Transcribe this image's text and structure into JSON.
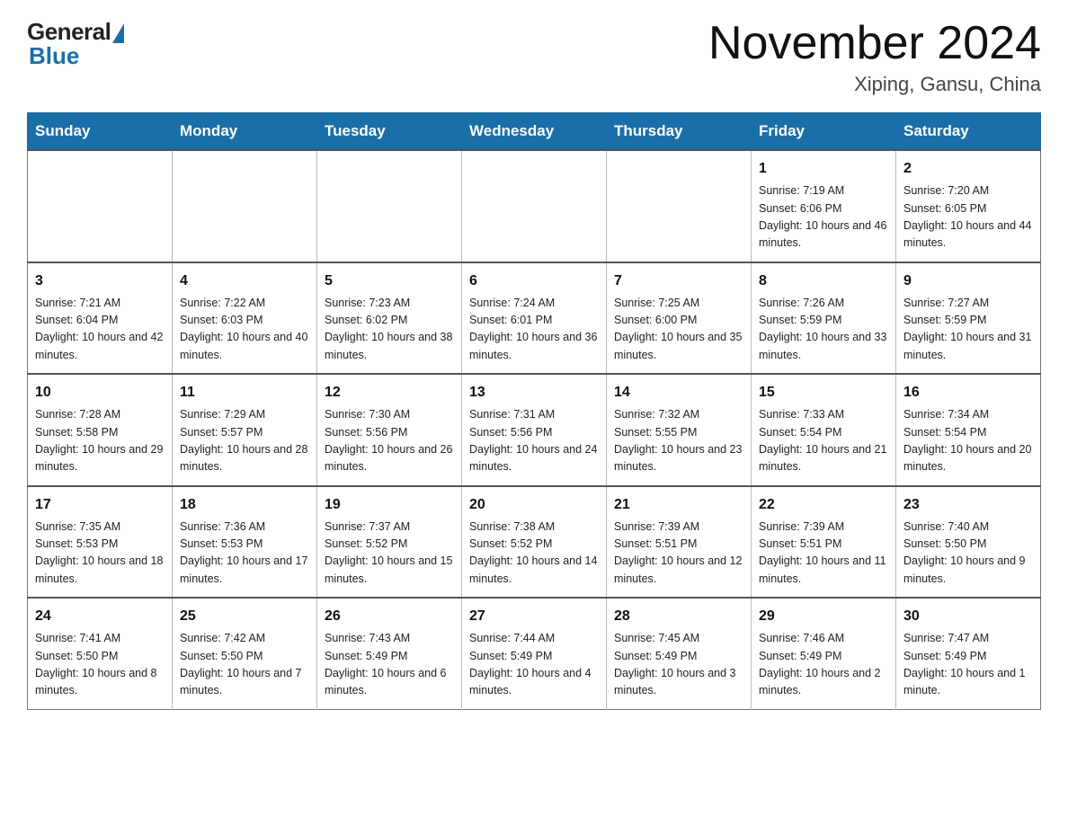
{
  "header": {
    "logo_general": "General",
    "logo_blue": "Blue",
    "month_title": "November 2024",
    "location": "Xiping, Gansu, China"
  },
  "weekdays": [
    "Sunday",
    "Monday",
    "Tuesday",
    "Wednesday",
    "Thursday",
    "Friday",
    "Saturday"
  ],
  "weeks": [
    [
      {
        "day": "",
        "info": ""
      },
      {
        "day": "",
        "info": ""
      },
      {
        "day": "",
        "info": ""
      },
      {
        "day": "",
        "info": ""
      },
      {
        "day": "",
        "info": ""
      },
      {
        "day": "1",
        "info": "Sunrise: 7:19 AM\nSunset: 6:06 PM\nDaylight: 10 hours and 46 minutes."
      },
      {
        "day": "2",
        "info": "Sunrise: 7:20 AM\nSunset: 6:05 PM\nDaylight: 10 hours and 44 minutes."
      }
    ],
    [
      {
        "day": "3",
        "info": "Sunrise: 7:21 AM\nSunset: 6:04 PM\nDaylight: 10 hours and 42 minutes."
      },
      {
        "day": "4",
        "info": "Sunrise: 7:22 AM\nSunset: 6:03 PM\nDaylight: 10 hours and 40 minutes."
      },
      {
        "day": "5",
        "info": "Sunrise: 7:23 AM\nSunset: 6:02 PM\nDaylight: 10 hours and 38 minutes."
      },
      {
        "day": "6",
        "info": "Sunrise: 7:24 AM\nSunset: 6:01 PM\nDaylight: 10 hours and 36 minutes."
      },
      {
        "day": "7",
        "info": "Sunrise: 7:25 AM\nSunset: 6:00 PM\nDaylight: 10 hours and 35 minutes."
      },
      {
        "day": "8",
        "info": "Sunrise: 7:26 AM\nSunset: 5:59 PM\nDaylight: 10 hours and 33 minutes."
      },
      {
        "day": "9",
        "info": "Sunrise: 7:27 AM\nSunset: 5:59 PM\nDaylight: 10 hours and 31 minutes."
      }
    ],
    [
      {
        "day": "10",
        "info": "Sunrise: 7:28 AM\nSunset: 5:58 PM\nDaylight: 10 hours and 29 minutes."
      },
      {
        "day": "11",
        "info": "Sunrise: 7:29 AM\nSunset: 5:57 PM\nDaylight: 10 hours and 28 minutes."
      },
      {
        "day": "12",
        "info": "Sunrise: 7:30 AM\nSunset: 5:56 PM\nDaylight: 10 hours and 26 minutes."
      },
      {
        "day": "13",
        "info": "Sunrise: 7:31 AM\nSunset: 5:56 PM\nDaylight: 10 hours and 24 minutes."
      },
      {
        "day": "14",
        "info": "Sunrise: 7:32 AM\nSunset: 5:55 PM\nDaylight: 10 hours and 23 minutes."
      },
      {
        "day": "15",
        "info": "Sunrise: 7:33 AM\nSunset: 5:54 PM\nDaylight: 10 hours and 21 minutes."
      },
      {
        "day": "16",
        "info": "Sunrise: 7:34 AM\nSunset: 5:54 PM\nDaylight: 10 hours and 20 minutes."
      }
    ],
    [
      {
        "day": "17",
        "info": "Sunrise: 7:35 AM\nSunset: 5:53 PM\nDaylight: 10 hours and 18 minutes."
      },
      {
        "day": "18",
        "info": "Sunrise: 7:36 AM\nSunset: 5:53 PM\nDaylight: 10 hours and 17 minutes."
      },
      {
        "day": "19",
        "info": "Sunrise: 7:37 AM\nSunset: 5:52 PM\nDaylight: 10 hours and 15 minutes."
      },
      {
        "day": "20",
        "info": "Sunrise: 7:38 AM\nSunset: 5:52 PM\nDaylight: 10 hours and 14 minutes."
      },
      {
        "day": "21",
        "info": "Sunrise: 7:39 AM\nSunset: 5:51 PM\nDaylight: 10 hours and 12 minutes."
      },
      {
        "day": "22",
        "info": "Sunrise: 7:39 AM\nSunset: 5:51 PM\nDaylight: 10 hours and 11 minutes."
      },
      {
        "day": "23",
        "info": "Sunrise: 7:40 AM\nSunset: 5:50 PM\nDaylight: 10 hours and 9 minutes."
      }
    ],
    [
      {
        "day": "24",
        "info": "Sunrise: 7:41 AM\nSunset: 5:50 PM\nDaylight: 10 hours and 8 minutes."
      },
      {
        "day": "25",
        "info": "Sunrise: 7:42 AM\nSunset: 5:50 PM\nDaylight: 10 hours and 7 minutes."
      },
      {
        "day": "26",
        "info": "Sunrise: 7:43 AM\nSunset: 5:49 PM\nDaylight: 10 hours and 6 minutes."
      },
      {
        "day": "27",
        "info": "Sunrise: 7:44 AM\nSunset: 5:49 PM\nDaylight: 10 hours and 4 minutes."
      },
      {
        "day": "28",
        "info": "Sunrise: 7:45 AM\nSunset: 5:49 PM\nDaylight: 10 hours and 3 minutes."
      },
      {
        "day": "29",
        "info": "Sunrise: 7:46 AM\nSunset: 5:49 PM\nDaylight: 10 hours and 2 minutes."
      },
      {
        "day": "30",
        "info": "Sunrise: 7:47 AM\nSunset: 5:49 PM\nDaylight: 10 hours and 1 minute."
      }
    ]
  ]
}
